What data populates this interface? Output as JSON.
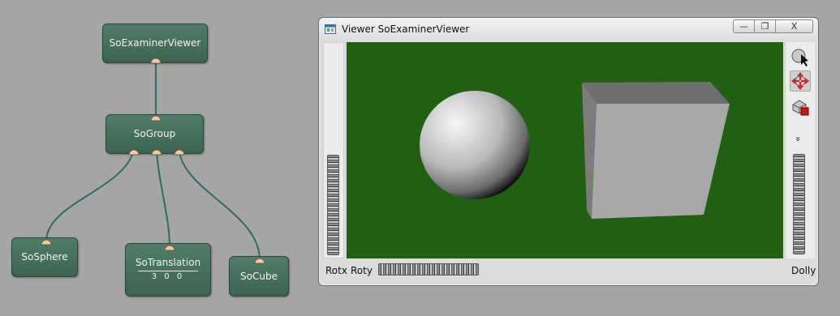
{
  "graph": {
    "nodes": {
      "examiner": {
        "label": "SoExaminerViewer"
      },
      "group": {
        "label": "SoGroup"
      },
      "sphere": {
        "label": "SoSphere"
      },
      "translation": {
        "label": "SoTranslation",
        "value": "3 0 0"
      },
      "cube": {
        "label": "SoCube"
      }
    },
    "colors": {
      "node": "#44705b",
      "connector": "#2f6a66",
      "port": "#f3c9a0"
    }
  },
  "viewer": {
    "title": "Viewer SoExaminerViewer",
    "window_icon": "viewer-window-icon",
    "title_buttons": {
      "minimize": {
        "icon": "minimize-icon",
        "glyph": "—"
      },
      "restore": {
        "icon": "restore-icon",
        "glyph": "❐"
      },
      "close": {
        "icon": "close-icon",
        "glyph": "X"
      }
    },
    "background_color": "#216012",
    "side_buttons": [
      {
        "name": "pick-mode-button",
        "icon": "pick-arrow-icon"
      },
      {
        "name": "view-mode-button",
        "icon": "move-arrows-icon",
        "active": true
      },
      {
        "name": "seek-button",
        "icon": "seek-icon"
      }
    ],
    "more_glyph": "»",
    "wheels": {
      "rotx": "Rotx",
      "roty": "Roty",
      "dolly": "Dolly"
    }
  }
}
